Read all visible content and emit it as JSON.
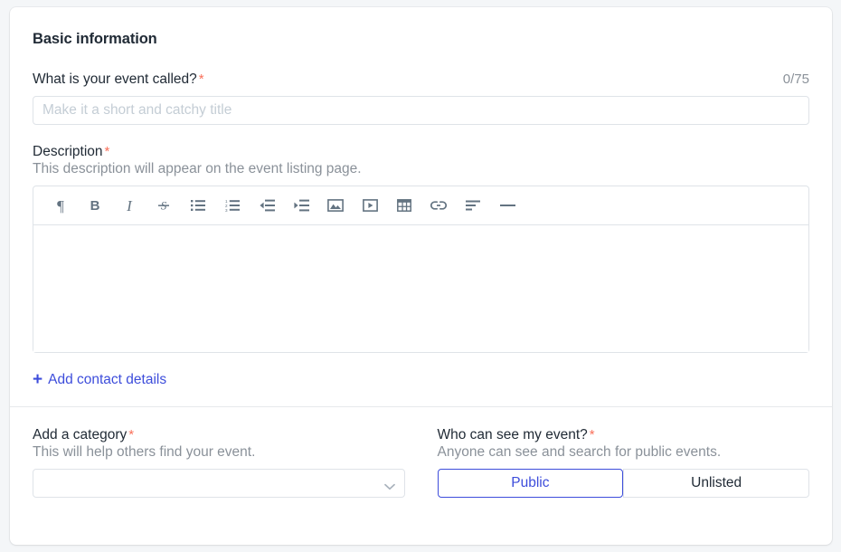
{
  "card": {
    "section_title": "Basic information",
    "required_marker": "*",
    "title_field": {
      "label": "What is your event called?",
      "required": true,
      "counter": "0/75",
      "value": "",
      "placeholder": "Make it a short and catchy title"
    },
    "description_field": {
      "label": "Description",
      "required": true,
      "helper": "This description will appear on the event listing page.",
      "value": "",
      "toolbar": [
        {
          "name": "paragraph-icon",
          "label": "¶",
          "kind": "glyph"
        },
        {
          "name": "bold-icon",
          "label": "B",
          "kind": "glyph-bold"
        },
        {
          "name": "italic-icon",
          "label": "I",
          "kind": "glyph-italic"
        },
        {
          "name": "strikethrough-icon",
          "label": "S",
          "kind": "svg"
        },
        {
          "name": "bulleted-list-icon",
          "label": "Bulleted list",
          "kind": "svg"
        },
        {
          "name": "numbered-list-icon",
          "label": "Numbered list",
          "kind": "svg"
        },
        {
          "name": "outdent-icon",
          "label": "Decrease indent",
          "kind": "svg"
        },
        {
          "name": "indent-icon",
          "label": "Increase indent",
          "kind": "svg"
        },
        {
          "name": "image-icon",
          "label": "Insert image",
          "kind": "svg"
        },
        {
          "name": "video-icon",
          "label": "Insert video",
          "kind": "svg"
        },
        {
          "name": "table-icon",
          "label": "Insert table",
          "kind": "svg"
        },
        {
          "name": "link-icon",
          "label": "Insert link",
          "kind": "svg"
        },
        {
          "name": "align-left-icon",
          "label": "Align left",
          "kind": "svg"
        },
        {
          "name": "horizontal-rule-icon",
          "label": "Horizontal rule",
          "kind": "svg"
        }
      ]
    },
    "add_contact_link": {
      "plus": "+",
      "label": "Add contact details"
    },
    "category_field": {
      "label": "Add a category",
      "required": true,
      "helper": "This will help others find your event.",
      "selected": "",
      "chevron": "chevron-down-icon"
    },
    "visibility_field": {
      "label": "Who can see my event?",
      "required": true,
      "helper": "Anyone can see and search for public events.",
      "options": [
        {
          "label": "Public",
          "selected": true
        },
        {
          "label": "Unlisted",
          "selected": false
        }
      ]
    }
  },
  "colors": {
    "page_bg": "#f4f6f8",
    "card_bg": "#ffffff",
    "text": "#212b36",
    "muted": "#8a9199",
    "accent": "#3d4ddb",
    "required": "#f9705a",
    "border": "#dfe3e8",
    "icon": "#637381"
  }
}
